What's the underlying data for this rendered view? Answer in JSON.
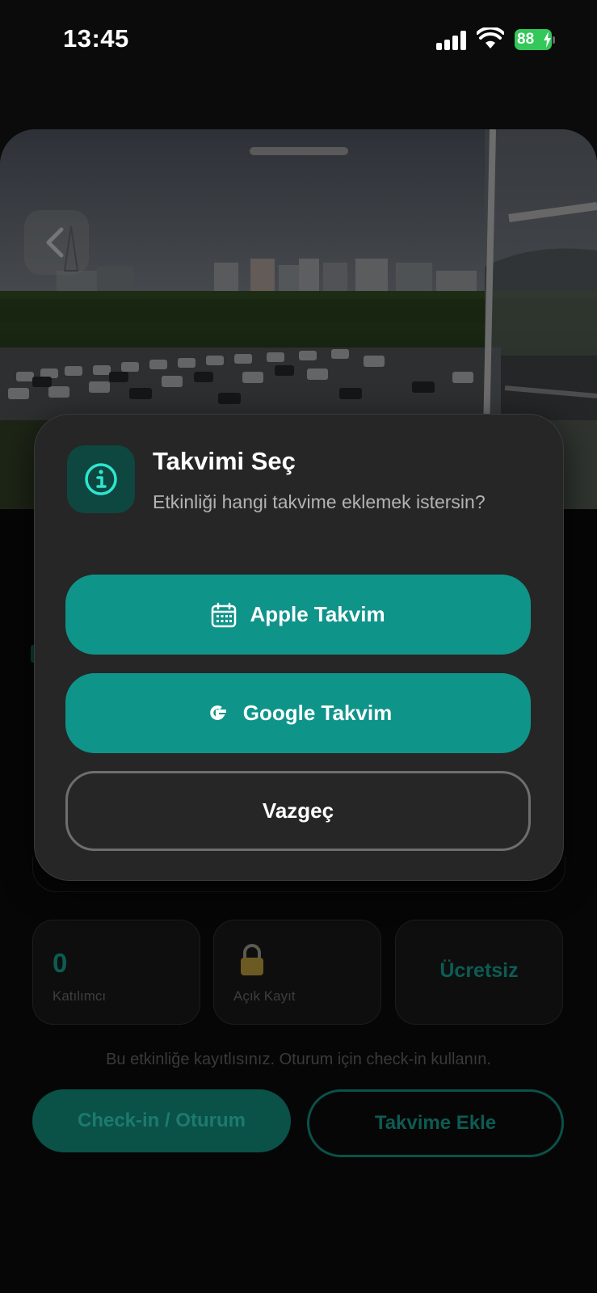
{
  "status_bar": {
    "time": "13:45",
    "battery": "88"
  },
  "dialog": {
    "title": "Takvimi Seç",
    "message": "Etkinliği hangi takvime eklemek istersin?",
    "apple_label": "Apple Takvim",
    "google_label": "Google Takvim",
    "cancel_label": "Vazgeç"
  },
  "event": {
    "participants_value": "0",
    "participants_label": "Katılımcı",
    "registration_label": "Açık Kayıt",
    "price_label": "Ücretsiz",
    "registered_note": "Bu etkinliğe kayıtlısınız. Oturum için check-in kullanın.",
    "checkin_label": "Check-in / Oturum",
    "add_calendar_label": "Takvime Ekle"
  },
  "colors": {
    "accent": "#0f948a",
    "dialog_bg": "#262626",
    "icon_box": "#0e4740",
    "battery": "#34c759"
  },
  "icons": [
    "info-icon",
    "calendar-icon",
    "google-g-icon",
    "lock-icon",
    "back-chevron-icon",
    "signal-icon",
    "wifi-icon",
    "battery-icon"
  ]
}
